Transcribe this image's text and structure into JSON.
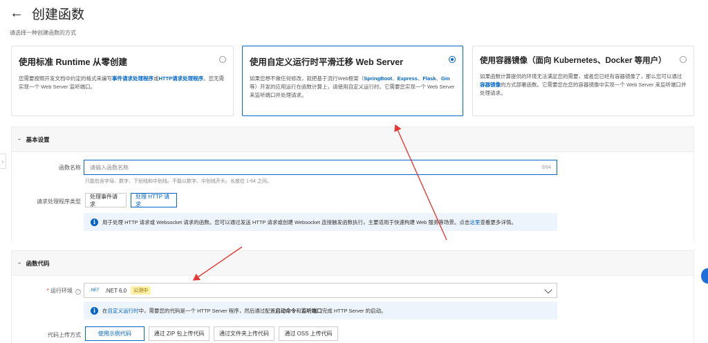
{
  "header": {
    "back_icon": "arrow-left-icon",
    "title": "创建函数",
    "subtitle": "请选择一种创建函数的方式"
  },
  "cards": [
    {
      "title": "使用标准 Runtime 从零创建",
      "desc_pre": "您需要按照开发文档中约定的格式来编写",
      "link1": "事件请求处理程序",
      "mid": "或",
      "link2": "HTTP请求处理程序",
      "desc_post": "。您无需实现一个 Web Server 监听端口。",
      "selected": false
    },
    {
      "title": "使用自定义运行时平滑迁移 Web Server",
      "desc_pre": "如果您想不做任何修改，就把基于流行Web框架（",
      "link1": "SpringBoot",
      "sep1": "、",
      "link2": "Express",
      "sep2": "、",
      "link3": "Flask",
      "sep3": "、",
      "link4": "Gin",
      "desc_post": " 等）开发的应用运行在函数计算上，请使用自定义运行时。它需要您实现一个 Web Server 来监听端口并处理请求。",
      "selected": true
    },
    {
      "title": "使用容器镜像（面向 Kubernetes、Docker 等用户）",
      "desc_pre": "如果函数计算提供的环境无法满足您的需要，或者您已经有容器镜像了，那么您可以通过",
      "link1": "容器镜像",
      "desc_post": "的方式部署函数。它需要您在您的容器镜像中实现一个 Web Server 来监听端口并处理请求。",
      "selected": false
    }
  ],
  "basic": {
    "section_title": "基本设置",
    "name_label": "函数名称",
    "name_placeholder": "请输入函数名称",
    "name_counter": "0/64",
    "name_hint": "只能包含字母、数字、下划线和中划线。不能以数字、中划线开头。长度在 1-64 之间。",
    "handler_label": "请求处理程序类型",
    "handler_options": [
      "处理事件请求",
      "处理 HTTP 请求"
    ],
    "info_pre": "用于处理 HTTP 请求或 Websocket 请求的函数。您可以通过发送 HTTP 请求或创建 Websocket 连接触发函数执行，主要适用于快速构建 Web 服务等场景。点击",
    "info_link": "这里",
    "info_post": "查看更多详情。"
  },
  "code": {
    "section_title": "函数代码",
    "runtime_label": "运行环境",
    "runtime_required": "*",
    "runtime_tag": ".NET",
    "runtime_value": ".NET 6.0",
    "runtime_badge": "公测中",
    "info_pre": "在",
    "info_link": "自定义运行时",
    "info_mid": "中，需要您的代码是一个 HTTP Server 程序，然后通过配置",
    "info_b1": "启动命令",
    "info_and": "和",
    "info_b2": "监听端口",
    "info_post": "完成 HTTP Server 的启动。",
    "upload_label": "代码上传方式",
    "upload_options": [
      "使用示例代码",
      "通过 ZIP 包上传代码",
      "通过文件夹上传代码",
      "通过 OSS 上传代码"
    ]
  },
  "colors": {
    "accent": "#0064c8",
    "arrow": "#e53935"
  }
}
